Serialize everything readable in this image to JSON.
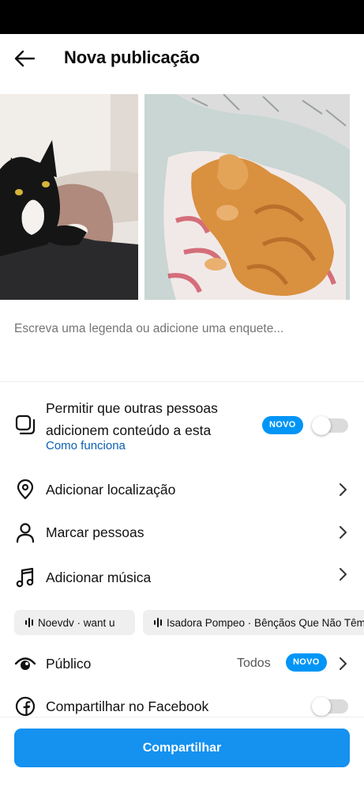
{
  "header": {
    "title": "Nova publicação",
    "back_icon": "arrow-left-icon"
  },
  "caption": {
    "placeholder": "Escreva uma legenda ou adicione uma enquete..."
  },
  "collaboration": {
    "label": "Permitir que outras pessoas adicionem conteúdo a esta",
    "link": "Como funciona",
    "badge": "NOVO",
    "toggle_on": false,
    "icon": "stacked-squares-icon"
  },
  "options": [
    {
      "label": "Adicionar localização",
      "icon": "location-pin-icon"
    },
    {
      "label": "Marcar pessoas",
      "icon": "person-icon"
    },
    {
      "label": "Adicionar música",
      "icon": "music-note-icon"
    }
  ],
  "music_suggestions": [
    {
      "label": "Noevdv · want u"
    },
    {
      "label": "Isadora Pompeo · Bênçãos Que Não Têm Fim"
    }
  ],
  "audience": {
    "label": "Público",
    "value": "Todos",
    "badge": "NOVO",
    "icon": "eye-icon"
  },
  "facebook": {
    "label": "Compartilhar no Facebook",
    "toggle_on": false,
    "icon": "facebook-icon"
  },
  "footer": {
    "share_label": "Compartilhar"
  },
  "colors": {
    "accent": "#0095f6",
    "share_button": "#1591f0",
    "link": "#0a5fb4"
  }
}
